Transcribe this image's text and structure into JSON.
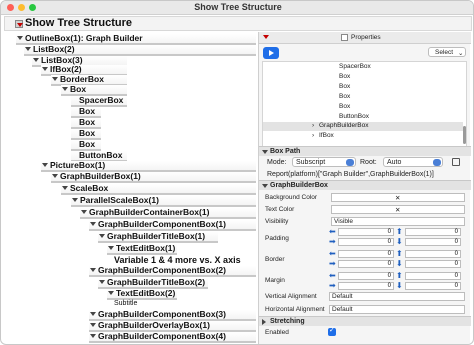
{
  "window": {
    "title": "Show Tree Structure"
  },
  "tree": {
    "root_label": "Show Tree Structure",
    "nodes": [
      {
        "label": "OutlineBox(1): Graph Builder"
      },
      {
        "label": "ListBox(2)"
      },
      {
        "label": "ListBox(3)"
      },
      {
        "label": "IfBox(2)"
      },
      {
        "label": "BorderBox"
      },
      {
        "label": "Box"
      },
      {
        "label": "SpacerBox"
      },
      {
        "label": "Box"
      },
      {
        "label": "Box"
      },
      {
        "label": "Box"
      },
      {
        "label": "Box"
      },
      {
        "label": "ButtonBox"
      },
      {
        "label": "PictureBox(1)"
      },
      {
        "label": "GraphBuilderBox(1)"
      },
      {
        "label": "ScaleBox"
      },
      {
        "label": "ParallelScaleBox(1)"
      },
      {
        "label": "GraphBuilderContainerBox(1)"
      },
      {
        "label": "GraphBuilderComponentBox(1)"
      },
      {
        "label": "GraphBuilderTitleBox(1)"
      },
      {
        "label": "TextEditBox(1)"
      },
      {
        "label": "GraphBuilderComponentBox(2)"
      },
      {
        "label": "GraphBuilderTitleBox(2)"
      },
      {
        "label": "TextEditBox(2)"
      },
      {
        "label": "GraphBuilderComponentBox(3)"
      },
      {
        "label": "GraphBuilderOverlayBox(1)"
      },
      {
        "label": "GraphBuilderComponentBox(4)"
      }
    ],
    "plain_texts": {
      "variable_caption": "Variable 1 & 4 more vs. X axis",
      "subtitle": "Subtitle"
    }
  },
  "properties": {
    "header_label": "Properties",
    "select_label": "Select",
    "list_items": [
      "SpacerBox",
      "Box",
      "Box",
      "Box",
      "Box",
      "ButtonBox",
      "GraphBuilderBox",
      "IfBox"
    ],
    "box_path": {
      "section_title": "Box Path",
      "mode_label": "Mode:",
      "mode_value": "Subscript",
      "root_label": "Root:",
      "root_value": "Auto",
      "path_text": "Report(platform)[\"Graph Builder\",GraphBuilderBox(1)]"
    },
    "gbb": {
      "section_title": "GraphBuilderBox",
      "background_color_label": "Background Color",
      "text_color_label": "Text Color",
      "visibility_label": "Visibility",
      "visibility_value": "Visible",
      "padding_label": "Padding",
      "border_label": "Border",
      "margin_label": "Margin",
      "zero": "0",
      "vertical_alignment_label": "Vertical Alignment",
      "vertical_alignment_value": "Default",
      "horizontal_alignment_label": "Horizontal Alignment",
      "horizontal_alignment_value": "Default"
    },
    "stretching": {
      "section_title": "Stretching",
      "enabled_label": "Enabled"
    }
  },
  "colors": {
    "accent": "#1f6ee8",
    "close": "#ff5f57",
    "minimize": "#febc2e",
    "zoom": "#28c840"
  }
}
